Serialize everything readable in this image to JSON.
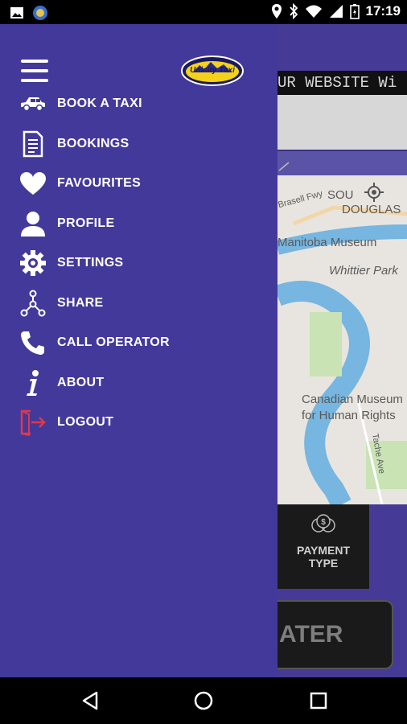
{
  "status_bar": {
    "time": "17:19",
    "icons": [
      "image-icon",
      "app-icon",
      "location-icon",
      "bluetooth-icon",
      "wifi-icon",
      "signal-icon",
      "battery-icon"
    ]
  },
  "drawer": {
    "logo_text": "Unicity Taxi",
    "items": [
      {
        "label": "BOOK A TAXI",
        "icon": "car-icon"
      },
      {
        "label": "BOOKINGS",
        "icon": "document-icon"
      },
      {
        "label": "FAVOURITES",
        "icon": "heart-icon"
      },
      {
        "label": "PROFILE",
        "icon": "user-icon"
      },
      {
        "label": "SETTINGS",
        "icon": "gear-icon"
      },
      {
        "label": "SHARE",
        "icon": "share-icon"
      },
      {
        "label": "CALL OPERATOR",
        "icon": "phone-icon"
      },
      {
        "label": "ABOUT",
        "icon": "info-icon"
      },
      {
        "label": "LOGOUT",
        "icon": "logout-icon"
      }
    ]
  },
  "background": {
    "ticker_text": "UR WEBSITE Wi",
    "map_labels": {
      "road": "Brasell Fwy",
      "area1": "SOU",
      "area2": "DOUGLAS",
      "museum": "Manitoba Museum",
      "park": "Whittier Park",
      "cmhr1": "Canadian Museum",
      "cmhr2": "for Human Rights",
      "street": "Tache Ave"
    },
    "payment_label_1": "PAYMENT",
    "payment_label_2": "TYPE",
    "later_label": "ATER"
  },
  "colors": {
    "drawer_bg": "#43399a",
    "logout_icon": "#e0384a"
  }
}
